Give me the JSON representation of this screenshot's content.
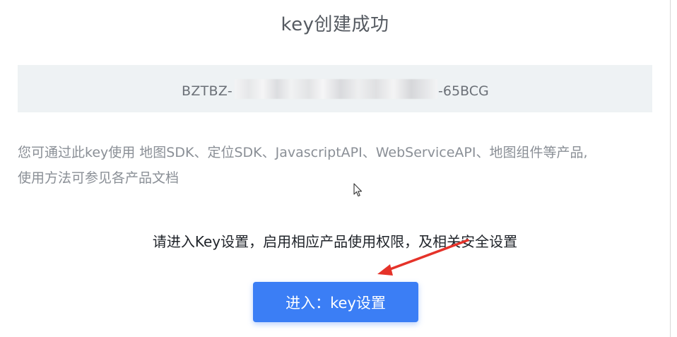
{
  "dialog": {
    "title": "key创建成功",
    "key": {
      "prefix": "BZTBZ-",
      "suffix": "-65BCG"
    },
    "description_line1": "您可通过此key使用 地图SDK、定位SDK、JavascriptAPI、WebServiceAPI、地图组件等产品,",
    "description_line2": "使用方法可参见各产品文档",
    "hint": "请进入Key设置，启用相应产品使用权限，及相关安全设置",
    "enter_button_label": "进入：key设置"
  },
  "colors": {
    "accent": "#3b7ef5",
    "annotation_arrow": "#e53229",
    "key_box_bg": "#eef2f4"
  },
  "icons": {
    "cursor": "mouse-pointer-icon",
    "annotation": "red-arrow-annotation"
  }
}
